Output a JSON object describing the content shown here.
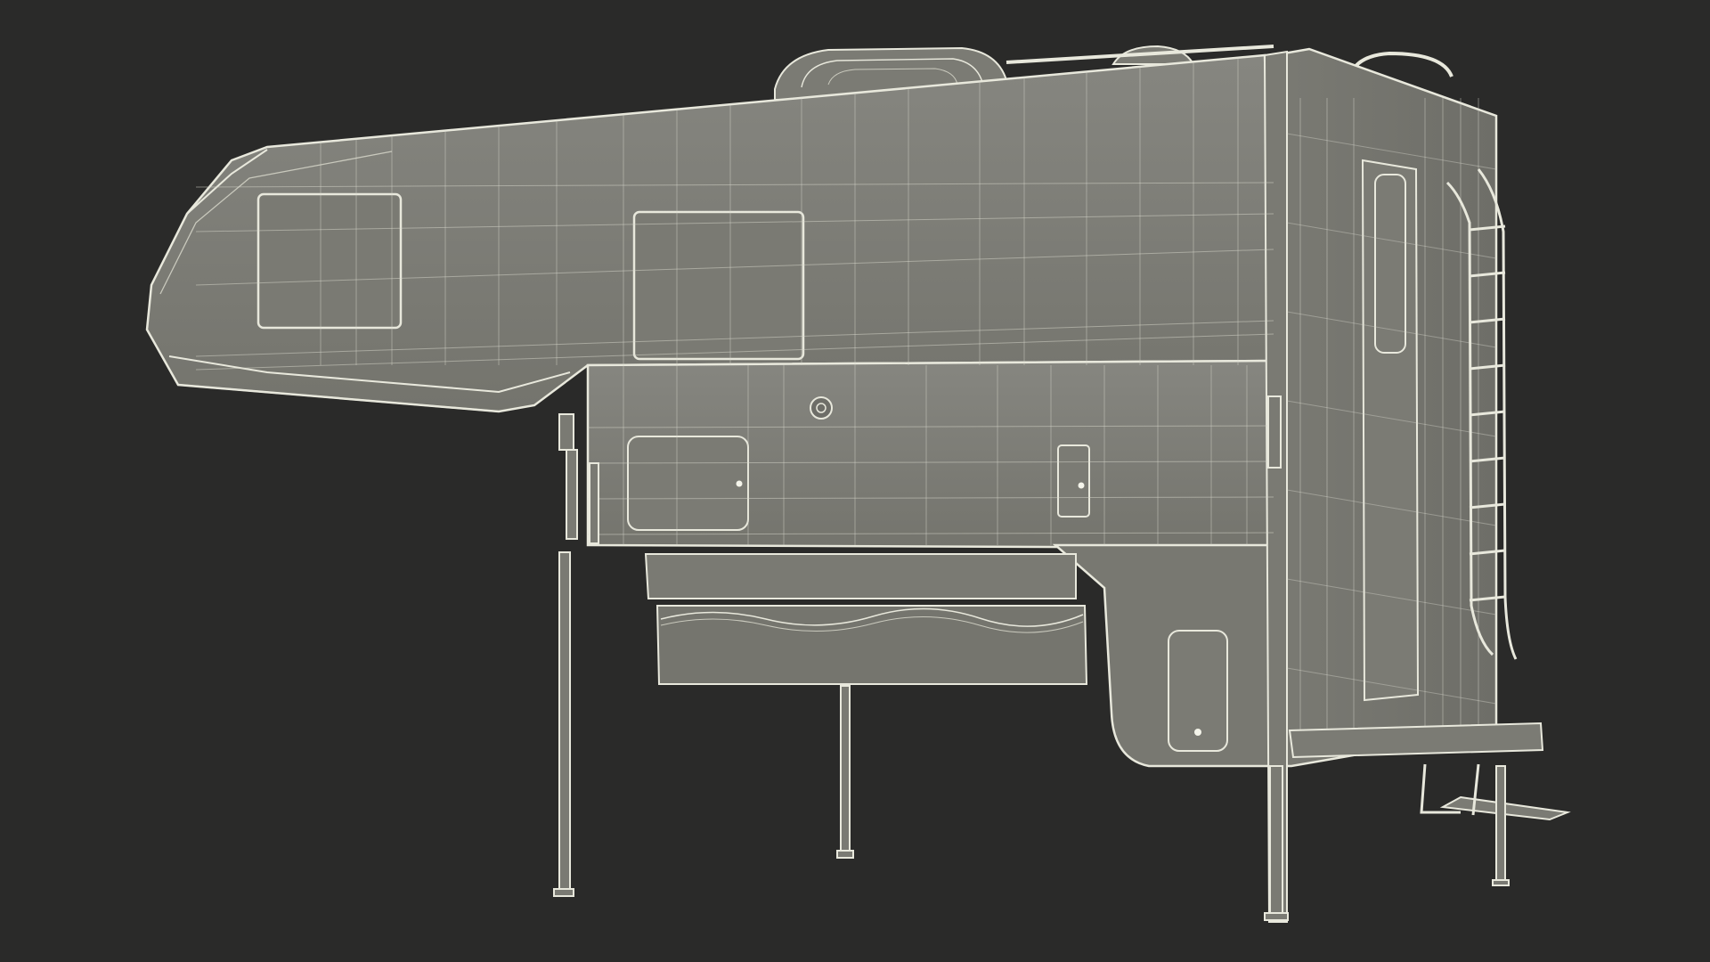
{
  "scene": {
    "background": "#2a2a29",
    "subject": "truck-camper-wireframe",
    "surface_color": "#7d7d76",
    "surface_dark": "#6a6a64",
    "surface_light": "#8a8a83",
    "wire_color": "#e8e8dc",
    "wire_faint": "#c9c9bd"
  }
}
